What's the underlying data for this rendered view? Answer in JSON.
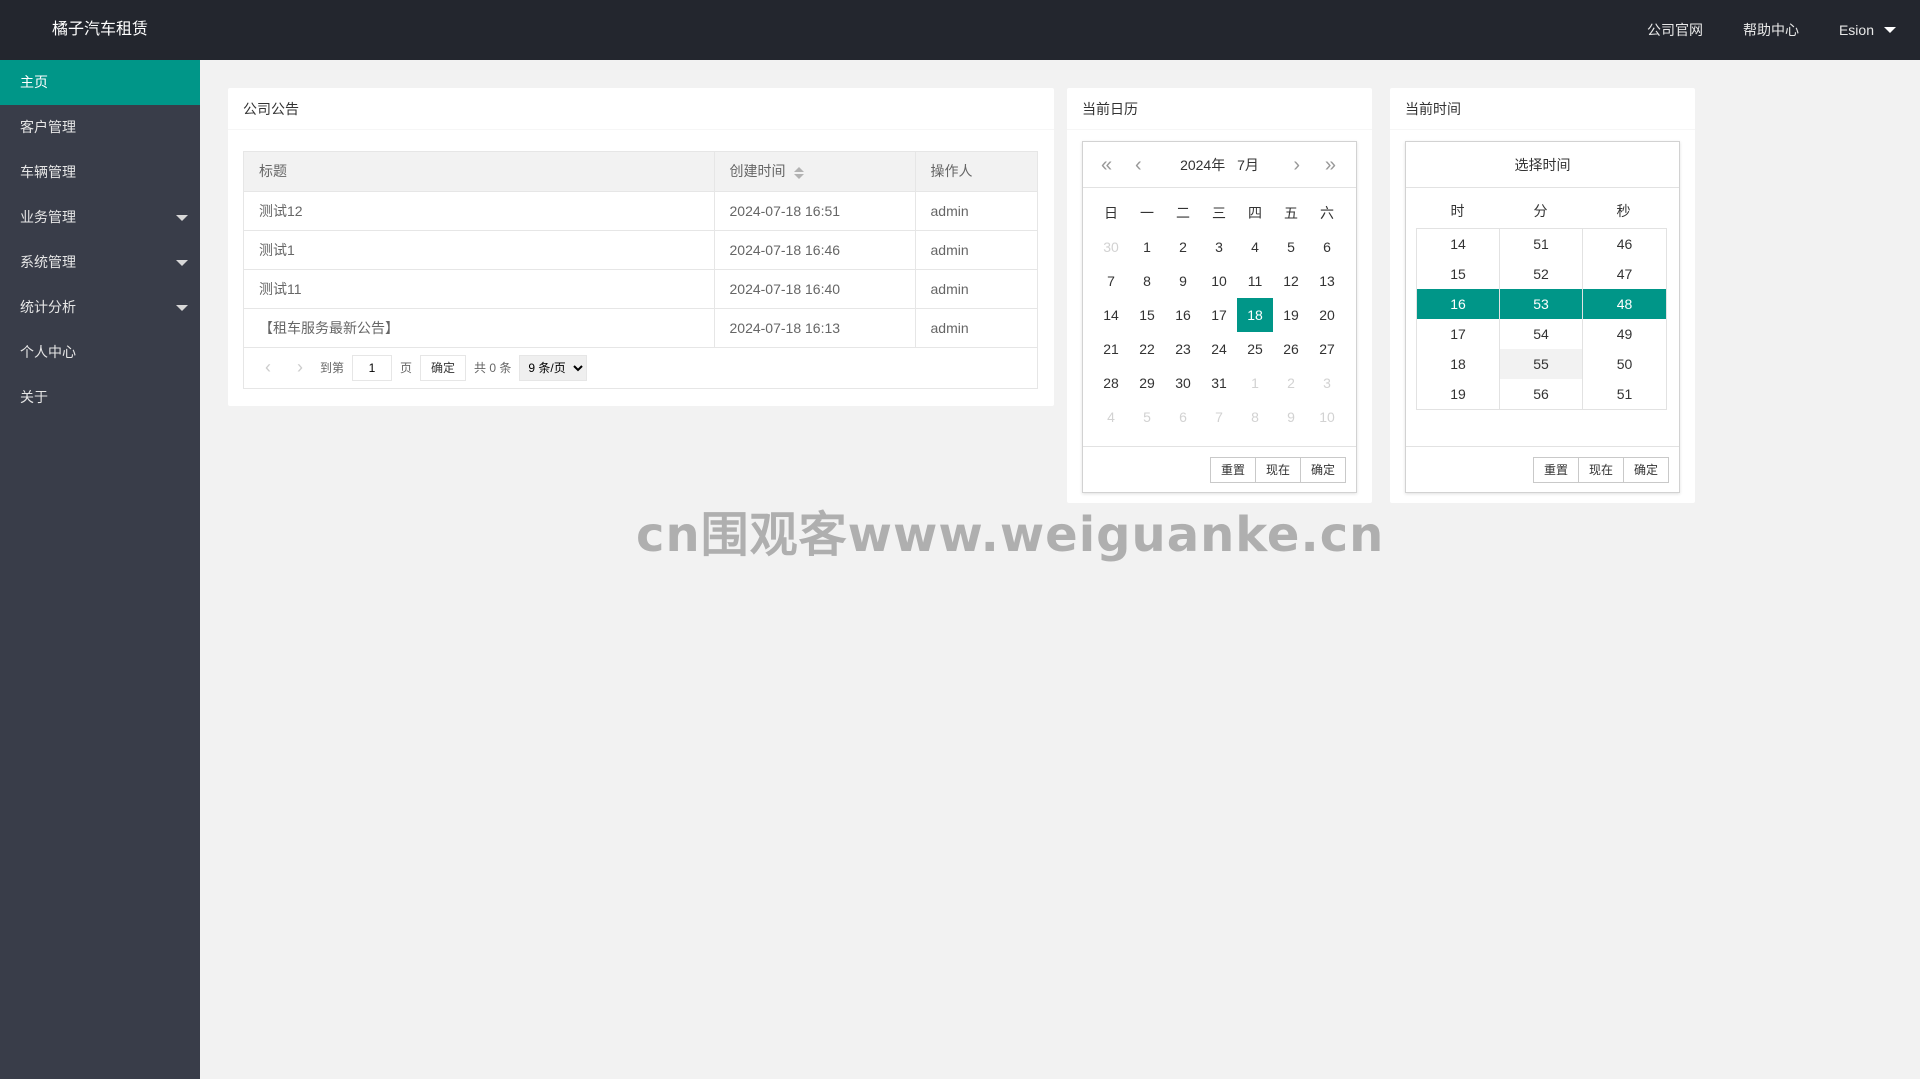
{
  "header": {
    "app_title": "橘子汽车租赁",
    "nav": [
      "公司官网",
      "帮助中心"
    ],
    "user_name": "Esion"
  },
  "sidebar": {
    "items": [
      {
        "label": "主页",
        "active": true,
        "has_children": false
      },
      {
        "label": "客户管理",
        "active": false,
        "has_children": false
      },
      {
        "label": "车辆管理",
        "active": false,
        "has_children": false
      },
      {
        "label": "业务管理",
        "active": false,
        "has_children": true
      },
      {
        "label": "系统管理",
        "active": false,
        "has_children": true
      },
      {
        "label": "统计分析",
        "active": false,
        "has_children": true
      },
      {
        "label": "个人中心",
        "active": false,
        "has_children": false
      },
      {
        "label": "关于",
        "active": false,
        "has_children": false
      }
    ]
  },
  "notice_card": {
    "title": "公司公告",
    "columns": [
      "标题",
      "创建时间",
      "操作人"
    ],
    "rows": [
      [
        "测试12",
        "2024-07-18 16:51",
        "admin"
      ],
      [
        "测试1",
        "2024-07-18 16:46",
        "admin"
      ],
      [
        "测试11",
        "2024-07-18 16:40",
        "admin"
      ],
      [
        "【租车服务最新公告】",
        "2024-07-18 16:13",
        "admin"
      ]
    ],
    "pager": {
      "goto_label": "到第",
      "page_value": "1",
      "page_unit": "页",
      "confirm_label": "确定",
      "total_label": "共 0 条",
      "page_size": "9 条/页",
      "page_size_options": [
        "9 条/页"
      ]
    }
  },
  "calendar_card": {
    "title": "当前日历",
    "year_label": "2024年",
    "month_label": "7月",
    "weekdays": [
      "日",
      "一",
      "二",
      "三",
      "四",
      "五",
      "六"
    ],
    "days": [
      {
        "d": "30",
        "muted": true
      },
      {
        "d": "1"
      },
      {
        "d": "2"
      },
      {
        "d": "3"
      },
      {
        "d": "4"
      },
      {
        "d": "5"
      },
      {
        "d": "6"
      },
      {
        "d": "7"
      },
      {
        "d": "8"
      },
      {
        "d": "9"
      },
      {
        "d": "10"
      },
      {
        "d": "11"
      },
      {
        "d": "12"
      },
      {
        "d": "13"
      },
      {
        "d": "14"
      },
      {
        "d": "15"
      },
      {
        "d": "16"
      },
      {
        "d": "17"
      },
      {
        "d": "18",
        "selected": true
      },
      {
        "d": "19"
      },
      {
        "d": "20"
      },
      {
        "d": "21"
      },
      {
        "d": "22"
      },
      {
        "d": "23"
      },
      {
        "d": "24"
      },
      {
        "d": "25"
      },
      {
        "d": "26"
      },
      {
        "d": "27"
      },
      {
        "d": "28"
      },
      {
        "d": "29"
      },
      {
        "d": "30"
      },
      {
        "d": "31"
      },
      {
        "d": "1",
        "muted": true
      },
      {
        "d": "2",
        "muted": true
      },
      {
        "d": "3",
        "muted": true
      },
      {
        "d": "4",
        "muted": true
      },
      {
        "d": "5",
        "muted": true
      },
      {
        "d": "6",
        "muted": true
      },
      {
        "d": "7",
        "muted": true
      },
      {
        "d": "8",
        "muted": true
      },
      {
        "d": "9",
        "muted": true
      },
      {
        "d": "10",
        "muted": true
      }
    ],
    "buttons": [
      "重置",
      "现在",
      "确定"
    ]
  },
  "time_card": {
    "title": "当前时间",
    "picker_title": "选择时间",
    "col_labels": [
      "时",
      "分",
      "秒"
    ],
    "hours": [
      "14",
      "15",
      "16",
      "17",
      "18",
      "19"
    ],
    "minutes": [
      "51",
      "52",
      "53",
      "54",
      "55",
      "56"
    ],
    "seconds": [
      "46",
      "47",
      "48",
      "49",
      "50",
      "51"
    ],
    "selected_index": 2,
    "hover_minute_index": 4,
    "buttons": [
      "重置",
      "现在",
      "确定"
    ]
  },
  "watermark": "cn围观客www.weiguanke.cn",
  "colors": {
    "header_bg": "#23262e",
    "sidebar_bg": "#393d49",
    "accent": "#009688",
    "page_bg": "#f2f2f2"
  }
}
